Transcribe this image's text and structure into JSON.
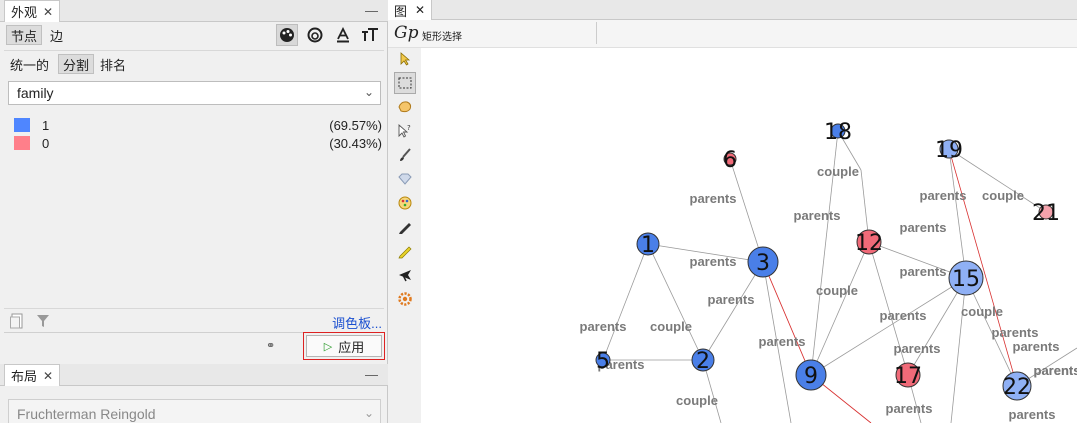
{
  "appearance_panel": {
    "tab_label": "外观",
    "close_glyph": "✕",
    "minimize_glyph": "—",
    "node_tab": "节点",
    "edge_tab": "边",
    "tool_icons": [
      "palette-icon",
      "size-icon",
      "label-color-icon",
      "label-size-icon"
    ],
    "mode_unified": "统一的",
    "mode_partition": "分割",
    "mode_ranking": "排名",
    "attribute_value": "family",
    "legend": [
      {
        "value": "1",
        "percent": "(69.57%)",
        "color": "#4f86ff"
      },
      {
        "value": "0",
        "percent": "(30.43%)",
        "color": "#ff7f8a"
      }
    ],
    "palette_link": "调色板...",
    "apply_label": "应用"
  },
  "layout_panel": {
    "tab_label": "布局",
    "close_glyph": "✕",
    "minimize_glyph": "—",
    "algorithm_value": "Fruchterman Reingold"
  },
  "graph_panel": {
    "tab_label": "图",
    "close_glyph": "✕",
    "logo_text": "Gp",
    "rect_select_label": "矩形选择",
    "tools": [
      "pointer-icon",
      "rect-select-icon",
      "lasso-icon",
      "help-pointer-icon",
      "brush-icon",
      "diamond-icon",
      "painter-icon",
      "pencil-icon",
      "pen-icon",
      "plane-icon",
      "gear-icon"
    ]
  },
  "graph": {
    "node_colors": {
      "blue": "#4a7fe8",
      "pink": "#f06a78",
      "light_blue": "#8fb0f5",
      "light_pink": "#f4a2ac"
    },
    "nodes": [
      {
        "id": "18",
        "color": "blue"
      },
      {
        "id": "6",
        "color": "pink"
      },
      {
        "id": "19",
        "color": "light_blue"
      },
      {
        "id": "21",
        "color": "light_pink"
      },
      {
        "id": "1",
        "color": "blue"
      },
      {
        "id": "3",
        "color": "blue"
      },
      {
        "id": "12",
        "color": "pink"
      },
      {
        "id": "15",
        "color": "light_blue"
      },
      {
        "id": "5",
        "color": "blue"
      },
      {
        "id": "2",
        "color": "blue"
      },
      {
        "id": "9",
        "color": "blue"
      },
      {
        "id": "17",
        "color": "pink"
      },
      {
        "id": "22",
        "color": "light_blue"
      }
    ],
    "edge_labels": [
      "parents",
      "couple",
      "parents",
      "parents",
      "couple",
      "parents",
      "parents",
      "couple",
      "parents",
      "parents",
      "parents",
      "couple",
      "parents",
      "parents",
      "parents",
      "couple",
      "parents",
      "parents",
      "parents",
      "couple",
      "parents",
      "parents",
      "parents",
      "parents"
    ]
  }
}
